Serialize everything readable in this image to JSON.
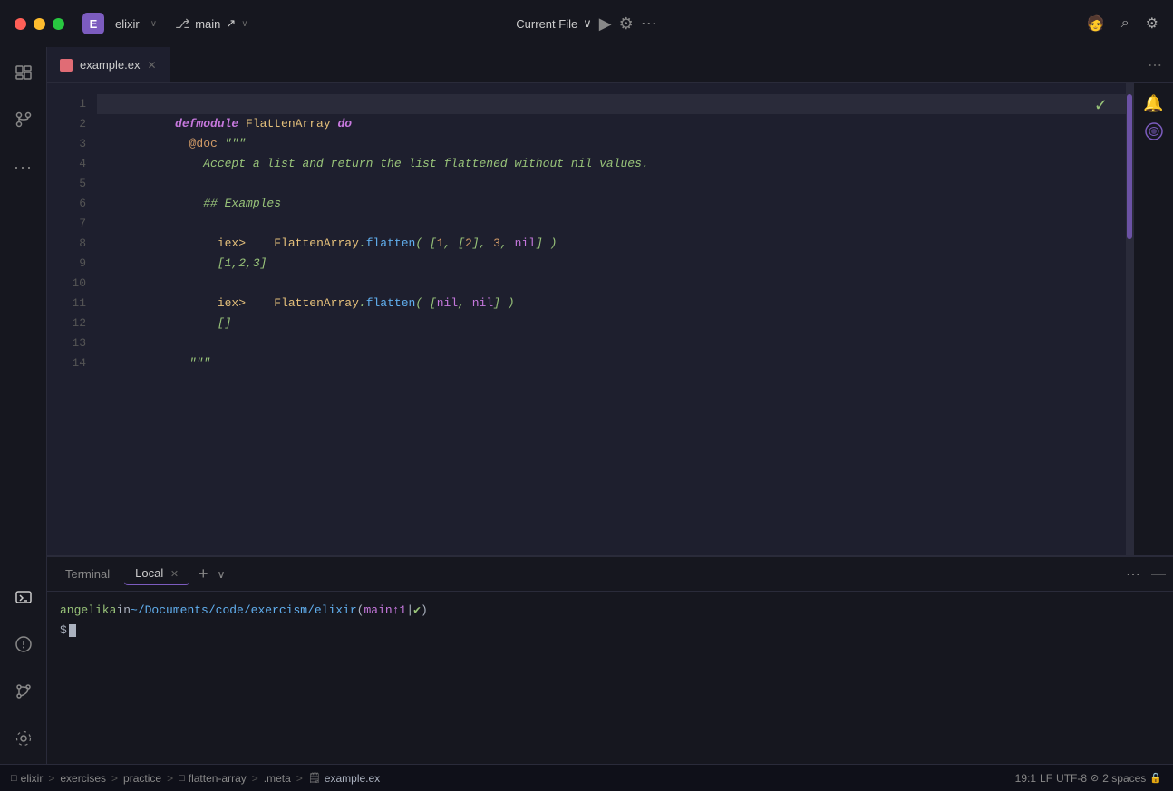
{
  "titlebar": {
    "app_icon": "E",
    "app_name": "elixir",
    "branch_name": "main",
    "branch_arrow": "↗",
    "current_file_label": "Current File",
    "run_icon": "▶",
    "settings_icon": "⚙",
    "more_icon": "⋯",
    "add_profile_icon": "👤+",
    "search_icon": "🔍",
    "gear_icon": "⚙"
  },
  "tabs": [
    {
      "name": "example.ex",
      "active": true,
      "closeable": true
    }
  ],
  "code": {
    "lines": [
      {
        "num": 1,
        "content": "defmodule FlattenArray do",
        "highlighted": true
      },
      {
        "num": 2,
        "content": "  @doc \"\"\""
      },
      {
        "num": 3,
        "content": "    Accept a list and return the list flattened without nil values."
      },
      {
        "num": 4,
        "content": ""
      },
      {
        "num": 5,
        "content": "    ## Examples"
      },
      {
        "num": 6,
        "content": ""
      },
      {
        "num": 7,
        "content": "      iex>    FlattenArray.flatten( [1, [2], 3, nil] )"
      },
      {
        "num": 8,
        "content": "      [1,2,3]"
      },
      {
        "num": 9,
        "content": ""
      },
      {
        "num": 10,
        "content": "      iex>    FlattenArray.flatten( [nil, nil] )"
      },
      {
        "num": 11,
        "content": "      []"
      },
      {
        "num": 12,
        "content": ""
      },
      {
        "num": 13,
        "content": "  \"\"\""
      },
      {
        "num": 14,
        "content": ""
      }
    ]
  },
  "terminal": {
    "tabs": [
      {
        "label": "Terminal",
        "active": false
      },
      {
        "label": "Local",
        "active": true,
        "closeable": true
      }
    ],
    "prompt_user": "angelika",
    "prompt_in": " in ",
    "prompt_path": "~/Documents/code/exercism/elixir",
    "prompt_branch_open": " (main",
    "prompt_branch_arrow": "↑1",
    "prompt_sep": " | ",
    "prompt_check": "✔",
    "prompt_close": ")",
    "cursor_line": "$"
  },
  "statusbar": {
    "folder_icon": "□",
    "project": "elixir",
    "sep1": ">",
    "crumb2": "exercises",
    "sep2": ">",
    "crumb3": "practice",
    "sep3": ">",
    "folder2_icon": "□",
    "crumb4": "flatten-array",
    "sep4": ">",
    "crumb5": ".meta",
    "sep5": ">",
    "file_icon": "📄",
    "crumb6": "example.ex",
    "position": "19:1",
    "line_ending": "LF",
    "encoding": "UTF-8",
    "indent_icon": "⊘",
    "indent": "2 spaces",
    "lock_icon": "🔒"
  }
}
